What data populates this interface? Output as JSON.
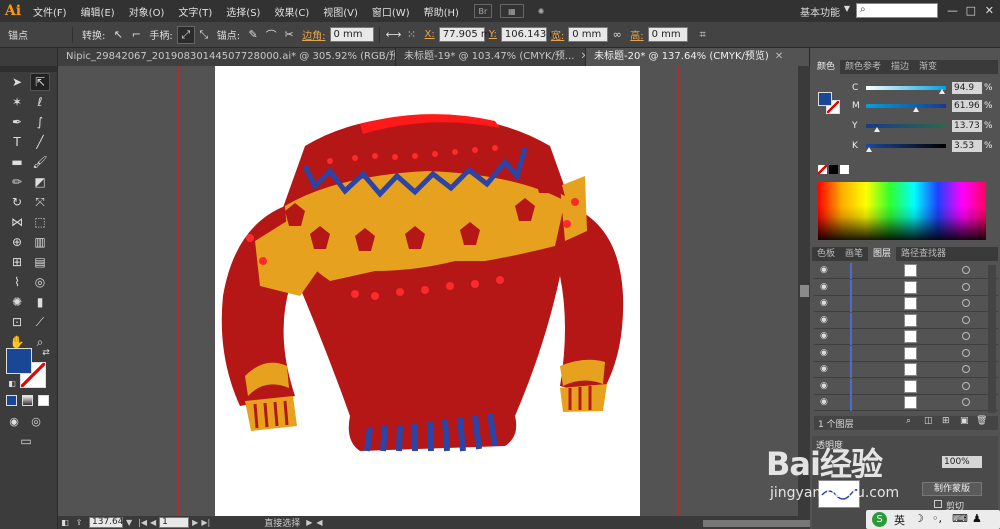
{
  "app": {
    "logo": "Ai",
    "menus": [
      "文件(F)",
      "编辑(E)",
      "对象(O)",
      "文字(T)",
      "选择(S)",
      "效果(C)",
      "视图(V)",
      "窗口(W)",
      "帮助(H)"
    ],
    "bridge_label": "Br",
    "workspace": "基本功能",
    "search_placeholder": "",
    "window_controls": [
      "—",
      "□",
      "✕"
    ]
  },
  "control_bar": {
    "anchor_label": "锚点",
    "convert_label": "转换:",
    "handles_label": "手柄:",
    "anchors_label": "锚点:",
    "corner_label": "边角:",
    "corner_value": "0 mm",
    "x_label": "X:",
    "x_value": "77.905 m",
    "y_label": "Y:",
    "y_value": "106.143 m",
    "w_label": "宽:",
    "w_value": "0 mm",
    "h_label": "高:",
    "h_value": "0 mm"
  },
  "tabs": [
    {
      "label": "Nipic_29842067_20190830144507728000.ai* @ 305.92% (RGB/预...",
      "active": false
    },
    {
      "label": "未标题-19* @ 103.47% (CMYK/预...",
      "active": false
    },
    {
      "label": "未标题-20* @ 137.64% (CMYK/预览)",
      "active": true
    }
  ],
  "color_panel": {
    "tabs": [
      "颜色",
      "颜色参考",
      "描边",
      "渐变"
    ],
    "channels": [
      {
        "label": "C",
        "value": "94.9",
        "level": 0.949,
        "from": "#ffffff",
        "to": "#00a0e0"
      },
      {
        "label": "M",
        "value": "61.96",
        "level": 0.6196,
        "from": "#00a0e0",
        "to": "#1a3a8a"
      },
      {
        "label": "Y",
        "value": "13.73",
        "level": 0.1373,
        "from": "#1a3a8a",
        "to": "#2a6a4a"
      },
      {
        "label": "K",
        "value": "3.53",
        "level": 0.0353,
        "from": "#1a4a9a",
        "to": "#000000"
      }
    ],
    "percent": "%",
    "fill_color": "#1a4696"
  },
  "layers_panel": {
    "tabs": [
      "色板",
      "画笔",
      "图层",
      "路径查找器"
    ],
    "rows": 9,
    "footer": "1 个图层"
  },
  "transparency_panel": {
    "tab": "透明度",
    "opacity": "100%",
    "make_mask": "制作蒙版",
    "clip": "剪切"
  },
  "status": {
    "zoom": "137.64",
    "page": "1",
    "tool": "直接选择"
  },
  "watermark": {
    "text": "Bai经验",
    "url": "jingyan.baidu.com"
  },
  "taskbar": {
    "ime": "英"
  },
  "colors": {
    "sweater_red": "#b51616",
    "sweater_yellow": "#e6a21e",
    "sweater_blue": "#2a44a8",
    "dot_red": "#ff2a2a"
  }
}
